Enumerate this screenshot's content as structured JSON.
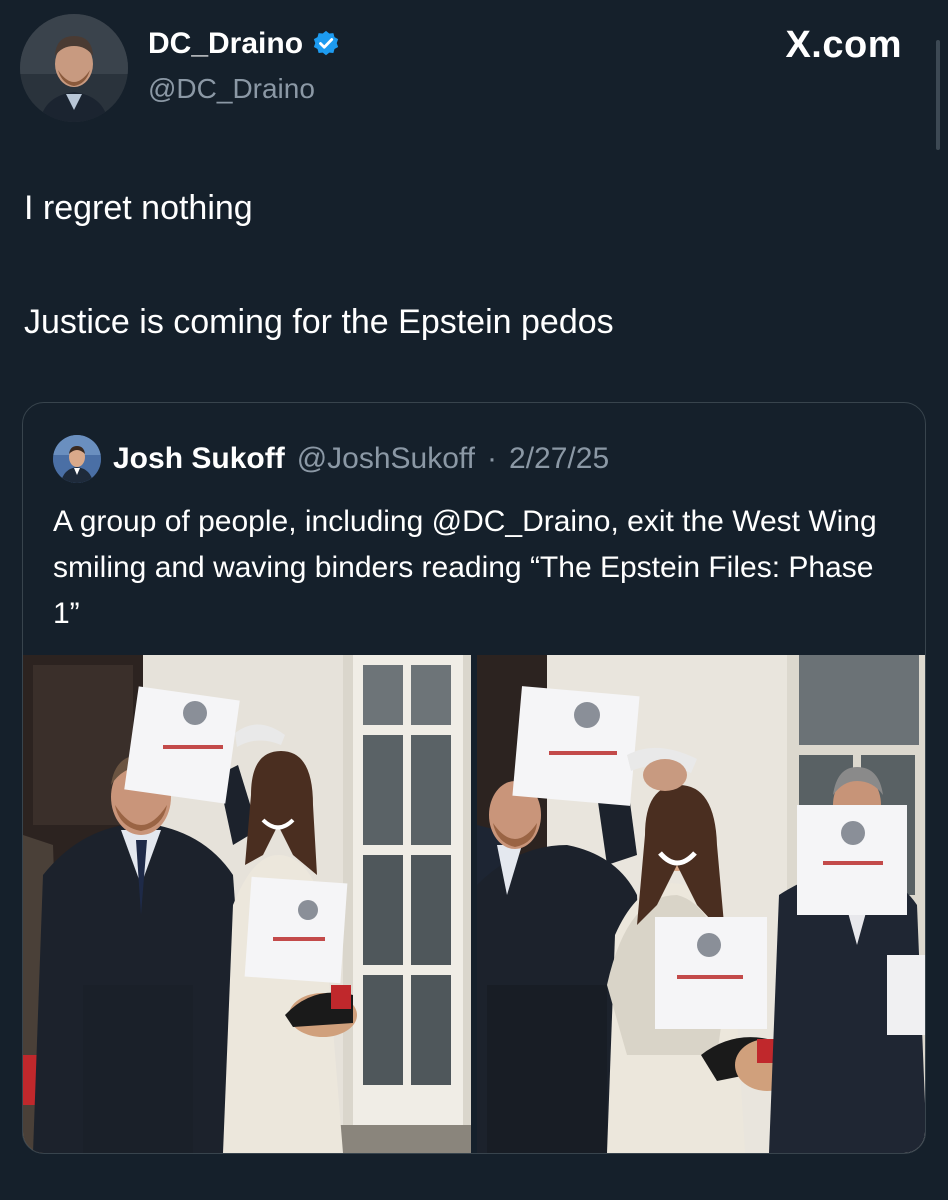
{
  "author": {
    "display_name": "DC_Draino",
    "handle": "@DC_Draino",
    "verified_icon": "verified-badge-icon"
  },
  "watermark": "X.com",
  "tweet": {
    "line1": "I regret nothing",
    "line2": "Justice is coming for the Epstein pedos"
  },
  "quote": {
    "name": "Josh Sukoff",
    "handle": "@JoshSukoff",
    "separator": "·",
    "date": "2/27/25",
    "text_before": "A group of people, including ",
    "mention": "@DC_Draino",
    "text_after": ", exit the West Wing smiling and waving binders reading “The Epstein Files: Phase 1”"
  },
  "colors": {
    "background": "#15202b",
    "border": "#38444d",
    "secondary_text": "#8b98a5",
    "verified": "#1d9bf0"
  }
}
